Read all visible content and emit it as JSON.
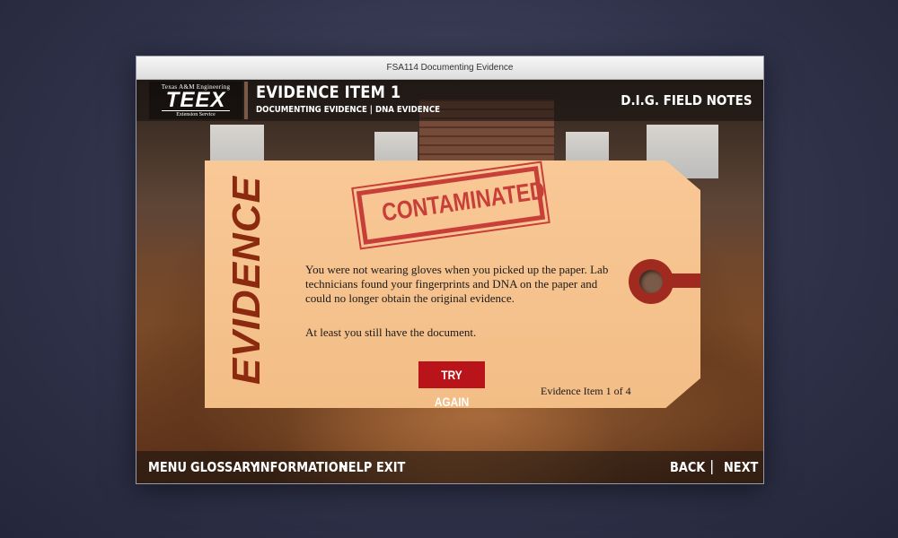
{
  "window": {
    "title": "FSA114 Documenting Evidence"
  },
  "header": {
    "logo": {
      "top": "Texas A&M Engineering",
      "mark": "TEEX",
      "bottom": "Extension Service"
    },
    "title": "EVIDENCE ITEM 1",
    "subtitle": "DOCUMENTING EVIDENCE | DNA EVIDENCE",
    "field_notes": "D.I.G.  FIELD NOTES"
  },
  "tag": {
    "side_label": "EVIDENCE",
    "stamp": "CONTAMINATED",
    "message": "You were not wearing gloves when you picked up the paper. Lab technicians found your fingerprints and DNA on the paper and could no longer obtain the original evidence.",
    "message2": "At least you still have the document.",
    "button": "TRY AGAIN",
    "counter": "Evidence Item 1 of 4"
  },
  "footer": {
    "menu": "MENU",
    "glossary": "GLOSSARY",
    "information": "INFORMATION",
    "help": "HELP",
    "exit": "EXIT",
    "back": "BACK",
    "separator": "|",
    "next": "NEXT"
  }
}
